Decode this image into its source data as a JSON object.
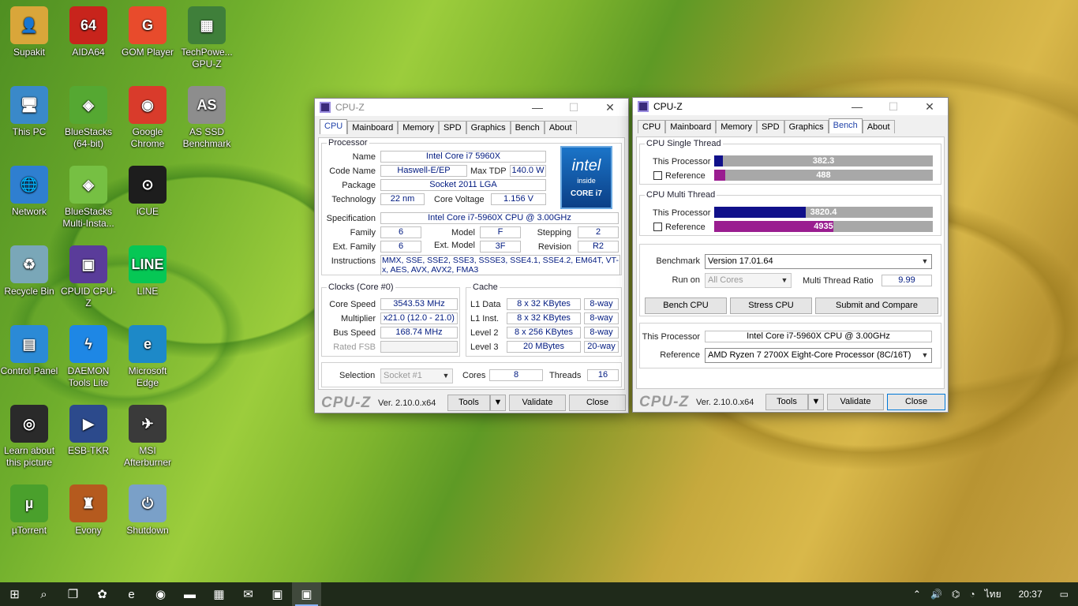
{
  "desktop": {
    "icons": [
      {
        "label": "Supakit",
        "glyph": "👤",
        "color": "#d9a63a"
      },
      {
        "label": "AIDA64",
        "glyph": "64",
        "color": "#c8241c"
      },
      {
        "label": "GOM Player",
        "glyph": "G",
        "color": "#e84b2c"
      },
      {
        "label": "TechPowe... GPU-Z",
        "glyph": "▦",
        "color": "#3f7f3a"
      },
      {
        "label": "This PC",
        "glyph": "🖥",
        "color": "#3a89c9"
      },
      {
        "label": "BlueStacks (64-bit)",
        "glyph": "◈",
        "color": "#55a832"
      },
      {
        "label": "Google Chrome",
        "glyph": "◉",
        "color": "#d93b2b"
      },
      {
        "label": "AS SSD Benchmark",
        "glyph": "AS",
        "color": "#8d8d8d"
      },
      {
        "label": "Network",
        "glyph": "🌐",
        "color": "#2f7fd0"
      },
      {
        "label": "BlueStacks Multi-Insta...",
        "glyph": "◈",
        "color": "#76c043"
      },
      {
        "label": "iCUE",
        "glyph": "⊙",
        "color": "#1d1d1d"
      },
      {
        "label": "Recycle Bin",
        "glyph": "♻",
        "color": "#7aa7b8"
      },
      {
        "label": "CPUID CPU-Z",
        "glyph": "▣",
        "color": "#5a3c9a"
      },
      {
        "label": "LINE",
        "glyph": "LINE",
        "color": "#06c755"
      },
      {
        "label": "Control Panel",
        "glyph": "▤",
        "color": "#2b8ad6"
      },
      {
        "label": "DAEMON Tools Lite",
        "glyph": "ϟ",
        "color": "#1e87e5"
      },
      {
        "label": "Microsoft Edge",
        "glyph": "e",
        "color": "#1d89c8"
      },
      {
        "label": "Learn about this picture",
        "glyph": "◎",
        "color": "#2a2a2a"
      },
      {
        "label": "ESB-TKR",
        "glyph": "▶",
        "color": "#2c4a8c"
      },
      {
        "label": "MSI Afterburner",
        "glyph": "✈",
        "color": "#3a3a3a"
      },
      {
        "label": "µTorrent",
        "glyph": "µ",
        "color": "#4aa02c"
      },
      {
        "label": "Evony",
        "glyph": "♜",
        "color": "#b55a1e"
      },
      {
        "label": "Shutdown",
        "glyph": "⏻",
        "color": "#7aa0c8"
      }
    ]
  },
  "cpuz1": {
    "title": "CPU-Z",
    "tabs": [
      "CPU",
      "Mainboard",
      "Memory",
      "SPD",
      "Graphics",
      "Bench",
      "About"
    ],
    "active_tab": "CPU",
    "processor": {
      "legend": "Processor",
      "name_label": "Name",
      "name": "Intel Core i7 5960X",
      "codename_label": "Code Name",
      "codename": "Haswell-E/EP",
      "maxtdp_label": "Max TDP",
      "maxtdp": "140.0 W",
      "package_label": "Package",
      "package": "Socket 2011 LGA",
      "technology_label": "Technology",
      "technology": "22 nm",
      "corevoltage_label": "Core Voltage",
      "corevoltage": "1.156 V",
      "spec_label": "Specification",
      "spec": "Intel Core i7-5960X CPU @ 3.00GHz",
      "family_label": "Family",
      "family": "6",
      "model_label": "Model",
      "model": "F",
      "stepping_label": "Stepping",
      "stepping": "2",
      "extfamily_label": "Ext. Family",
      "extfamily": "6",
      "extmodel_label": "Ext. Model",
      "extmodel": "3F",
      "revision_label": "Revision",
      "revision": "R2",
      "instructions_label": "Instructions",
      "instructions": "MMX, SSE, SSE2, SSE3, SSSE3, SSE4.1, SSE4.2, EM64T, VT-x, AES, AVX, AVX2, FMA3",
      "logo_line1": "intel",
      "logo_line2": "inside",
      "logo_line3": "CORE i7"
    },
    "clocks": {
      "legend": "Clocks (Core #0)",
      "corespeed_label": "Core Speed",
      "corespeed": "3543.53 MHz",
      "multiplier_label": "Multiplier",
      "multiplier": "x21.0 (12.0 - 21.0)",
      "busspeed_label": "Bus Speed",
      "busspeed": "168.74 MHz",
      "ratedfsb_label": "Rated FSB",
      "ratedfsb": ""
    },
    "cache": {
      "legend": "Cache",
      "l1data_label": "L1 Data",
      "l1data": "8 x 32 KBytes",
      "l1data_way": "8-way",
      "l1inst_label": "L1 Inst.",
      "l1inst": "8 x 32 KBytes",
      "l1inst_way": "8-way",
      "level2_label": "Level 2",
      "level2": "8 x 256 KBytes",
      "level2_way": "8-way",
      "level3_label": "Level 3",
      "level3": "20 MBytes",
      "level3_way": "20-way"
    },
    "selection": {
      "selection_label": "Selection",
      "socket": "Socket #1",
      "cores_label": "Cores",
      "cores": "8",
      "threads_label": "Threads",
      "threads": "16"
    },
    "bottom": {
      "brand": "CPU-Z",
      "version": "Ver. 2.10.0.x64",
      "tools": "Tools",
      "validate": "Validate",
      "close": "Close"
    }
  },
  "cpuz2": {
    "title": "CPU-Z",
    "tabs": [
      "CPU",
      "Mainboard",
      "Memory",
      "SPD",
      "Graphics",
      "Bench",
      "About"
    ],
    "active_tab": "Bench",
    "single": {
      "legend": "CPU Single Thread",
      "this_label": "This Processor",
      "this_value": "382.3",
      "this_fraction": 0.0399,
      "ref_label": "Reference",
      "ref_value": "488",
      "ref_fraction": 0.0509
    },
    "multi": {
      "legend": "CPU Multi Thread",
      "this_label": "This Processor",
      "this_value": "3820.4",
      "this_fraction": 0.4204,
      "ref_label": "Reference",
      "ref_value": "4935",
      "ref_fraction": 0.5435
    },
    "bench": {
      "benchmark_label": "Benchmark",
      "benchmark": "Version 17.01.64",
      "runon_label": "Run on",
      "runon": "All Cores",
      "ratio_label": "Multi Thread Ratio",
      "ratio": "9.99",
      "bench_cpu": "Bench CPU",
      "stress_cpu": "Stress CPU",
      "submit": "Submit and Compare"
    },
    "compare": {
      "this_label": "This Processor",
      "this_value": "Intel Core i7-5960X CPU @ 3.00GHz",
      "ref_label": "Reference",
      "ref_value": "AMD Ryzen 7 2700X Eight-Core Processor (8C/16T)"
    },
    "bottom": {
      "brand": "CPU-Z",
      "version": "Ver. 2.10.0.x64",
      "tools": "Tools",
      "validate": "Validate",
      "close": "Close"
    },
    "colors": {
      "this_bar": "#10108a",
      "ref_bar": "#9a1d90"
    }
  },
  "taskbar": {
    "time": "20:37",
    "lang": "ไทย",
    "items": [
      {
        "name": "start-button",
        "glyph": "⊞"
      },
      {
        "name": "search-icon",
        "glyph": "⌕"
      },
      {
        "name": "task-view-icon",
        "glyph": "❐"
      },
      {
        "name": "copilot-icon",
        "glyph": "✿"
      },
      {
        "name": "edge-icon",
        "glyph": "e"
      },
      {
        "name": "chrome-icon",
        "glyph": "◉"
      },
      {
        "name": "file-explorer-icon",
        "glyph": "▬"
      },
      {
        "name": "store-icon",
        "glyph": "▦"
      },
      {
        "name": "mail-icon",
        "glyph": "✉"
      },
      {
        "name": "app-icon",
        "glyph": "▣"
      },
      {
        "name": "cpuz-taskbar-icon",
        "glyph": "▣"
      }
    ]
  }
}
